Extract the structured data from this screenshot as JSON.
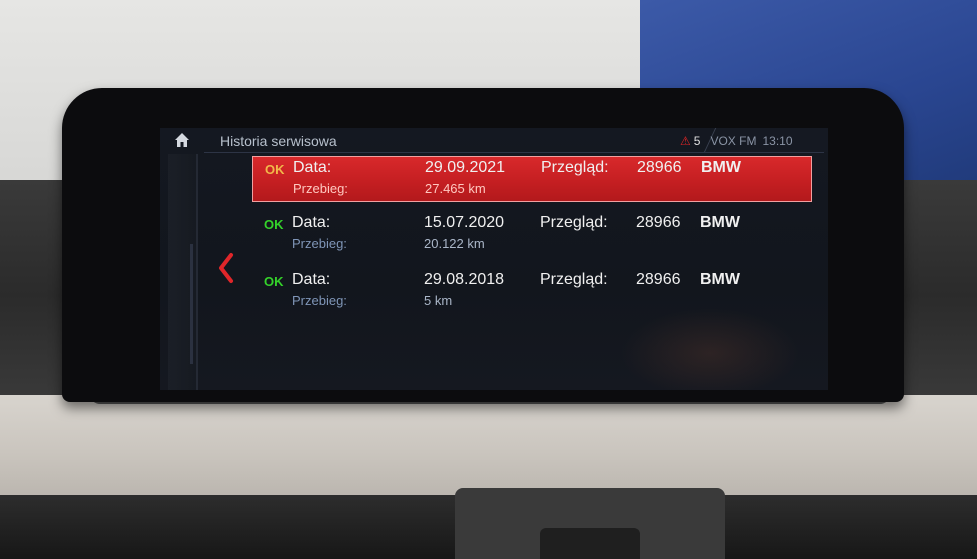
{
  "header": {
    "title": "Historia serwisowa",
    "status": {
      "warning_count": "5",
      "station": "VOX FM",
      "time": "13:10"
    }
  },
  "icons": {
    "home": "home-icon",
    "back": "chevron-left-icon",
    "warning": "warning-triangle-icon"
  },
  "colors": {
    "selection": "#c51f22",
    "ok_green": "#34d22a",
    "ok_amber": "#f2b84a",
    "warning": "#e02525"
  },
  "entries": [
    {
      "status": "OK",
      "date_label": "Data:",
      "date": "29.09.2021",
      "mileage_label": "Przebieg:",
      "mileage": "27.465 km",
      "service_label": "Przegląd:",
      "service_code": "28966",
      "brand": "BMW",
      "selected": true
    },
    {
      "status": "OK",
      "date_label": "Data:",
      "date": "15.07.2020",
      "mileage_label": "Przebieg:",
      "mileage": "20.122 km",
      "service_label": "Przegląd:",
      "service_code": "28966",
      "brand": "BMW",
      "selected": false
    },
    {
      "status": "OK",
      "date_label": "Data:",
      "date": "29.08.2018",
      "mileage_label": "Przebieg:",
      "mileage": "5 km",
      "service_label": "Przegląd:",
      "service_code": "28966",
      "brand": "BMW",
      "selected": false
    }
  ]
}
